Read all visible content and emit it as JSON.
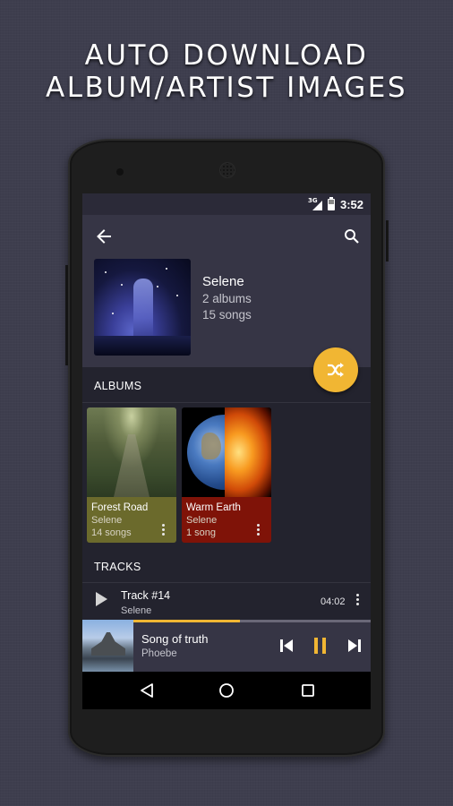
{
  "promo": {
    "line1": "AUTO DOWNLOAD",
    "line2": "ALBUM/ARTIST IMAGES"
  },
  "status_bar": {
    "network_label": "3G",
    "time": "3:52",
    "icons": [
      "signal-icon",
      "battery-charging-icon"
    ]
  },
  "toolbar": {
    "back_icon": "arrow-left-icon",
    "search_icon": "search-icon"
  },
  "artist": {
    "name": "Selene",
    "albums_count": "2 albums",
    "songs_count": "15 songs"
  },
  "fab": {
    "icon": "shuffle-icon",
    "color": "#f1b633"
  },
  "albums_section": {
    "title": "ALBUMS",
    "items": [
      {
        "title": "Forest Road",
        "artist": "Selene",
        "songs": "14 songs",
        "color": "#6b6a2c"
      },
      {
        "title": "Warm Earth",
        "artist": "Selene",
        "songs": "1 song",
        "color": "#7f1308"
      }
    ]
  },
  "tracks_section": {
    "title": "TRACKS",
    "items": [
      {
        "title": "Track #14",
        "artist": "Selene",
        "duration": "04:02"
      }
    ]
  },
  "now_playing": {
    "title": "Song of truth",
    "artist": "Phoebe",
    "progress_percent": 45,
    "state": "playing",
    "accent": "#f1b633"
  },
  "nav_bar": {
    "buttons": [
      "back",
      "home",
      "recents"
    ]
  }
}
